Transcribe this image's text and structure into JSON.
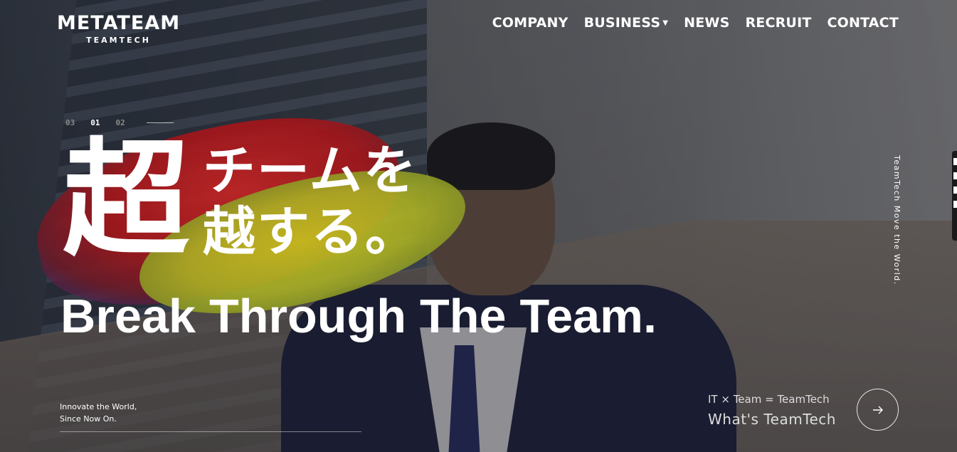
{
  "logo": {
    "main": "METATEAM",
    "sub": "TEAMTECH"
  },
  "nav": {
    "items": [
      {
        "label": "COMPANY"
      },
      {
        "label": "BUSINESS",
        "has_dropdown": true
      },
      {
        "label": "NEWS"
      },
      {
        "label": "RECRUIT"
      },
      {
        "label": "CONTACT"
      }
    ]
  },
  "slider": {
    "indicators": [
      "03",
      "01",
      "02"
    ],
    "active": "01"
  },
  "hero": {
    "kanji": "超",
    "jp_line1": "チームを",
    "jp_line2": "越する。",
    "en_title": "Break Through The Team."
  },
  "vertical_text": "TeamTech Move the World.",
  "tagline": {
    "line1": "Innovate the World,",
    "line2": "Since Now On."
  },
  "teamtech": {
    "equation": "IT × Team = TeamTech",
    "link": "What's TeamTech",
    "arrow_icon": "arrow-right-icon"
  },
  "colors": {
    "brush_red": "#c22424",
    "brush_yellow": "#c9c41f",
    "text": "#ffffff"
  }
}
